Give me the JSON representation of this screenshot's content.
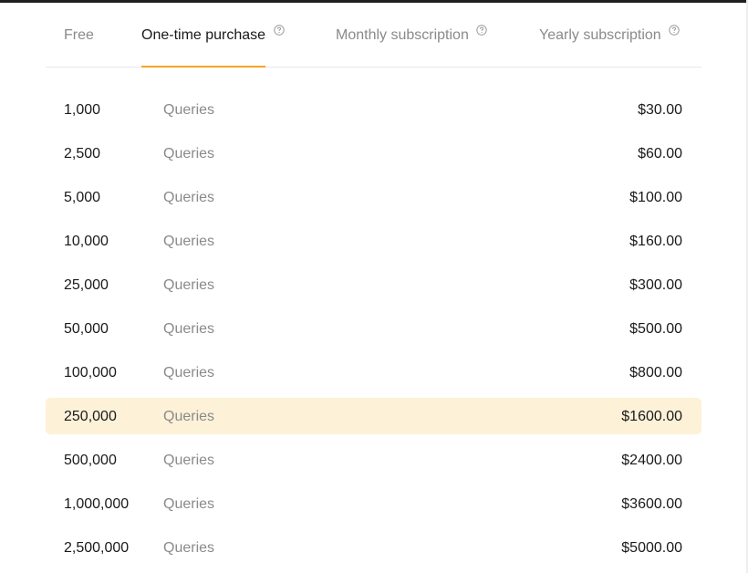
{
  "colors": {
    "accent": "#f5a623",
    "highlight_row": "#fdf1d8",
    "text_primary": "#1a1a1a",
    "text_muted": "#8a8a8a",
    "divider": "#e8e8e8"
  },
  "tabs": [
    {
      "label": "Free",
      "active": false,
      "help_icon": false
    },
    {
      "label": "One-time purchase",
      "active": true,
      "help_icon": "question-circle-icon"
    },
    {
      "label": "Monthly subscription",
      "active": false,
      "help_icon": "question-circle-icon"
    },
    {
      "label": "Yearly subscription",
      "active": false,
      "help_icon": "question-circle-icon"
    }
  ],
  "pricing": {
    "selected_index": 7,
    "rows": [
      {
        "amount": "1,000",
        "unit": "Queries",
        "price": "$30.00"
      },
      {
        "amount": "2,500",
        "unit": "Queries",
        "price": "$60.00"
      },
      {
        "amount": "5,000",
        "unit": "Queries",
        "price": "$100.00"
      },
      {
        "amount": "10,000",
        "unit": "Queries",
        "price": "$160.00"
      },
      {
        "amount": "25,000",
        "unit": "Queries",
        "price": "$300.00"
      },
      {
        "amount": "50,000",
        "unit": "Queries",
        "price": "$500.00"
      },
      {
        "amount": "100,000",
        "unit": "Queries",
        "price": "$800.00"
      },
      {
        "amount": "250,000",
        "unit": "Queries",
        "price": "$1600.00"
      },
      {
        "amount": "500,000",
        "unit": "Queries",
        "price": "$2400.00"
      },
      {
        "amount": "1,000,000",
        "unit": "Queries",
        "price": "$3600.00"
      },
      {
        "amount": "2,500,000",
        "unit": "Queries",
        "price": "$5000.00"
      }
    ]
  }
}
